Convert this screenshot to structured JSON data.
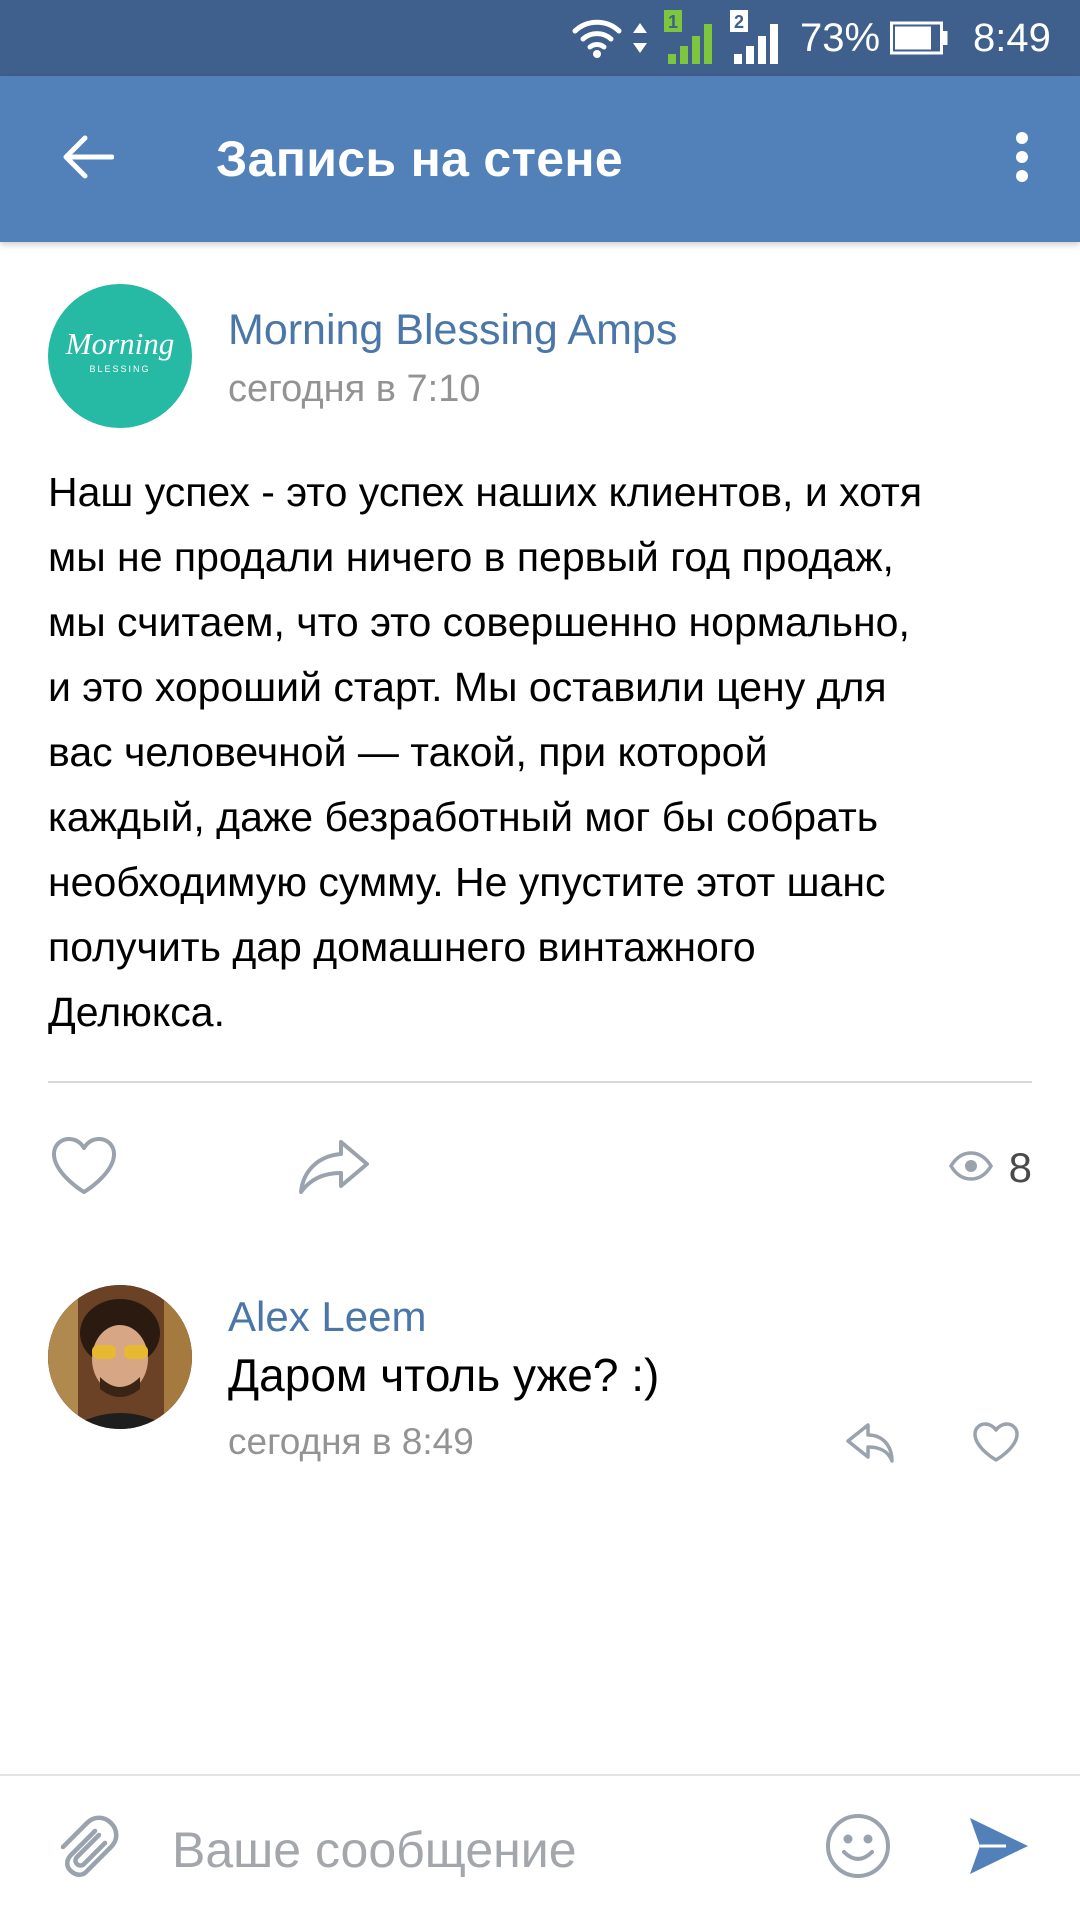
{
  "status_bar": {
    "battery_percent": "73%",
    "time": "8:49",
    "sim1_label": "1",
    "sim2_label": "2",
    "icons": [
      "wifi-icon",
      "data-arrows-icon",
      "signal-sim1-icon",
      "signal-sim2-icon",
      "battery-icon"
    ]
  },
  "app_bar": {
    "title": "Запись на стене",
    "icons": [
      "back-arrow-icon",
      "more-vert-icon"
    ],
    "color": "#5181b8"
  },
  "post": {
    "group_name": "Morning Blessing Amps",
    "logo_text": "Morning",
    "logo_subtext": "BLESSING",
    "time": "сегодня в 7:10",
    "text": "Наш успех - это успех наших клиентов, и хотя\nмы не продали ничего в первый год продаж,\nмы считаем, что это совершенно нормально,\nи это хороший старт. Мы оставили цену для\nвас человечной — такой, при которой\nкаждый, даже безработный мог бы собрать\nнеобходимую сумму. Не упустите этот шанс\nполучить дар домашнего винтажного\nДелюкса.",
    "views": "8",
    "icons": [
      "heart-outline-icon",
      "share-arrow-icon",
      "eye-icon"
    ]
  },
  "comment": {
    "author": "Alex Leem",
    "text": "Даром чтоль уже? :)",
    "time": "сегодня в 8:49",
    "icons": [
      "reply-icon",
      "heart-outline-icon"
    ]
  },
  "composer": {
    "placeholder": "Ваше сообщение",
    "value": "",
    "icons": [
      "paperclip-icon",
      "smiley-icon",
      "send-icon"
    ]
  },
  "colors": {
    "status_bar": "#3f5f8c",
    "link": "#4a76a8",
    "secondary_text": "#939393",
    "icon_gray": "#9aa4b0",
    "send_blue": "#5181b8",
    "group_avatar": "#26b9a3"
  }
}
